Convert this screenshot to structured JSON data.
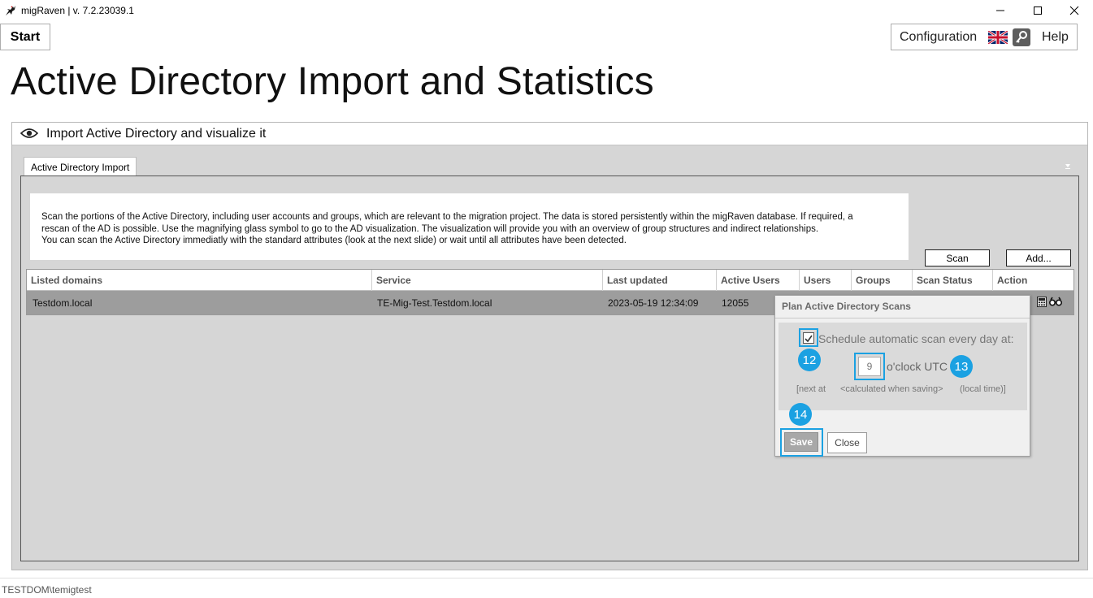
{
  "window": {
    "title": "migRaven | v. 7.2.23039.1"
  },
  "toolbar": {
    "start_label": "Start",
    "configuration_label": "Configuration",
    "help_label": "Help",
    "language_icon": "uk-flag-icon",
    "key_icon": "key-icon"
  },
  "page": {
    "title": "Active Directory Import and Statistics"
  },
  "panel": {
    "title": "Import Active Directory and visualize it",
    "tab_label": "Active Directory Import",
    "description": [
      "Scan the portions of the Active Directory, including user accounts and groups, which are relevant to the migration project. The data is stored persistently within the migRaven database. If required, a",
      "rescan of the AD is possible. Use the magnifying glass symbol to go to the AD visualization. The visualization will provide you with an overview of group structures and indirect relationships.",
      "You can scan the Active Directory immediatly with the standard attributes (look at the next slide) or wait until all attributes have been detected."
    ],
    "scan_label": "Scan",
    "add_label": "Add..."
  },
  "grid": {
    "columns": [
      "Listed domains",
      "Service",
      "Last updated",
      "Active Users",
      "Users",
      "Groups",
      "Scan Status",
      "Action"
    ],
    "rows": [
      {
        "domain": "Testdom.local",
        "service": "TE-Mig-Test.Testdom.local",
        "last_updated": "2023-05-19 12:34:09",
        "active_users": "12055"
      }
    ]
  },
  "popup": {
    "title": "Plan Active Directory Scans",
    "schedule_label": "Schedule automatic scan every day at:",
    "schedule_checked": true,
    "hour_value": "9",
    "oclock_label": "o'clock UTC",
    "next_at": "[next at",
    "calculated": "<calculated when saving>",
    "local_time": "(local time)]",
    "save_label": "Save",
    "close_label": "Close",
    "badges": [
      "12",
      "13",
      "14"
    ],
    "highlight_color": "#1ba1e2"
  },
  "status": {
    "user": "TESTDOM\\temigtest"
  }
}
